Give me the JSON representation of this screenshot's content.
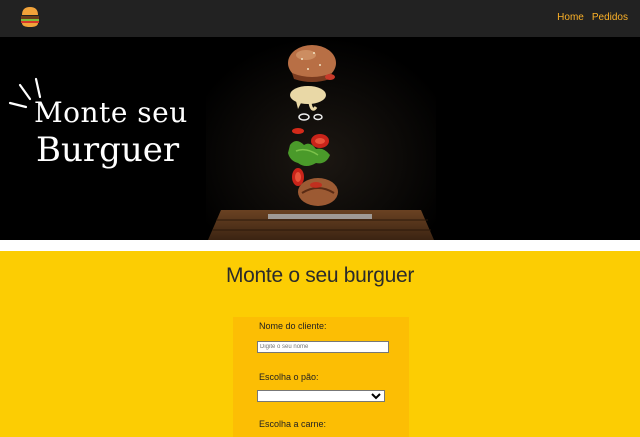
{
  "nav": {
    "logo_icon": "burger-icon",
    "links": [
      "Home",
      "Pedidos"
    ],
    "link_color": "#fcb127"
  },
  "hero": {
    "title_line1": "Monte seu",
    "title_line2": "Burguer"
  },
  "main": {
    "title": "Monte o seu burguer",
    "bg_color": "#fccd03"
  },
  "form": {
    "name_label": "Nome do cliente:",
    "name_placeholder": "Digite o seu nome",
    "bread_label": "Escolha o pão:",
    "bread_selected": "",
    "meat_label": "Escolha a carne:"
  }
}
